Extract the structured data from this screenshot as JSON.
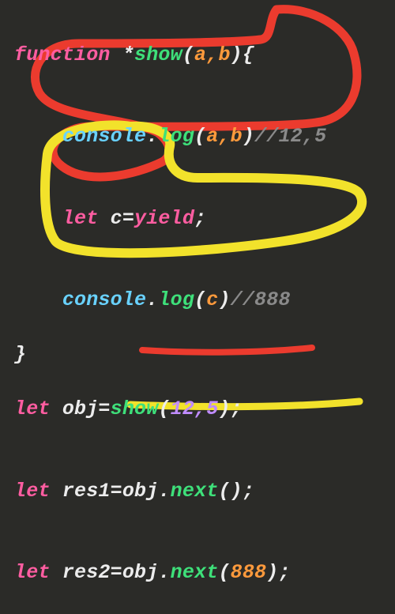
{
  "code": {
    "l1": {
      "kw_function": "function",
      "star": "*",
      "name": "show",
      "open": "(",
      "params": "a,b",
      "close": ")",
      "brace": "{"
    },
    "l2": {
      "obj": "console",
      "dot": ".",
      "method": "log",
      "open": "(",
      "args": "a,b",
      "close": ")",
      "comment": "//12,5"
    },
    "l3": {
      "kw_let": "let",
      "var": "c",
      "eq": "=",
      "kw_yield": "yield",
      "semi": ";"
    },
    "l4": {
      "obj": "console",
      "dot": ".",
      "method": "log",
      "open": "(",
      "args": "c",
      "close": ")",
      "comment": "//888"
    },
    "l5": {
      "brace": "}"
    },
    "l6": {
      "kw_let": "let",
      "var": "obj",
      "eq": "=",
      "fn": "show",
      "open": "(",
      "args": "12,5",
      "close": ")",
      "semi": ";"
    },
    "l7": {
      "kw_let": "let",
      "var": "res1",
      "eq": "=",
      "obj": "obj",
      "dot": ".",
      "method": "next",
      "open": "(",
      "close": ")",
      "semi": ";"
    },
    "l8": {
      "kw_let": "let",
      "var": "res2",
      "eq": "=",
      "obj": "obj",
      "dot": ".",
      "method": "next",
      "open": "(",
      "args": "888",
      "close": ")",
      "semi": ";"
    }
  },
  "annotations": {
    "red_group_color": "#eb3b2e",
    "yellow_group_color": "#f2e22b",
    "red_underline_color": "#eb3b2e",
    "yellow_underline_color": "#f2e22b"
  }
}
